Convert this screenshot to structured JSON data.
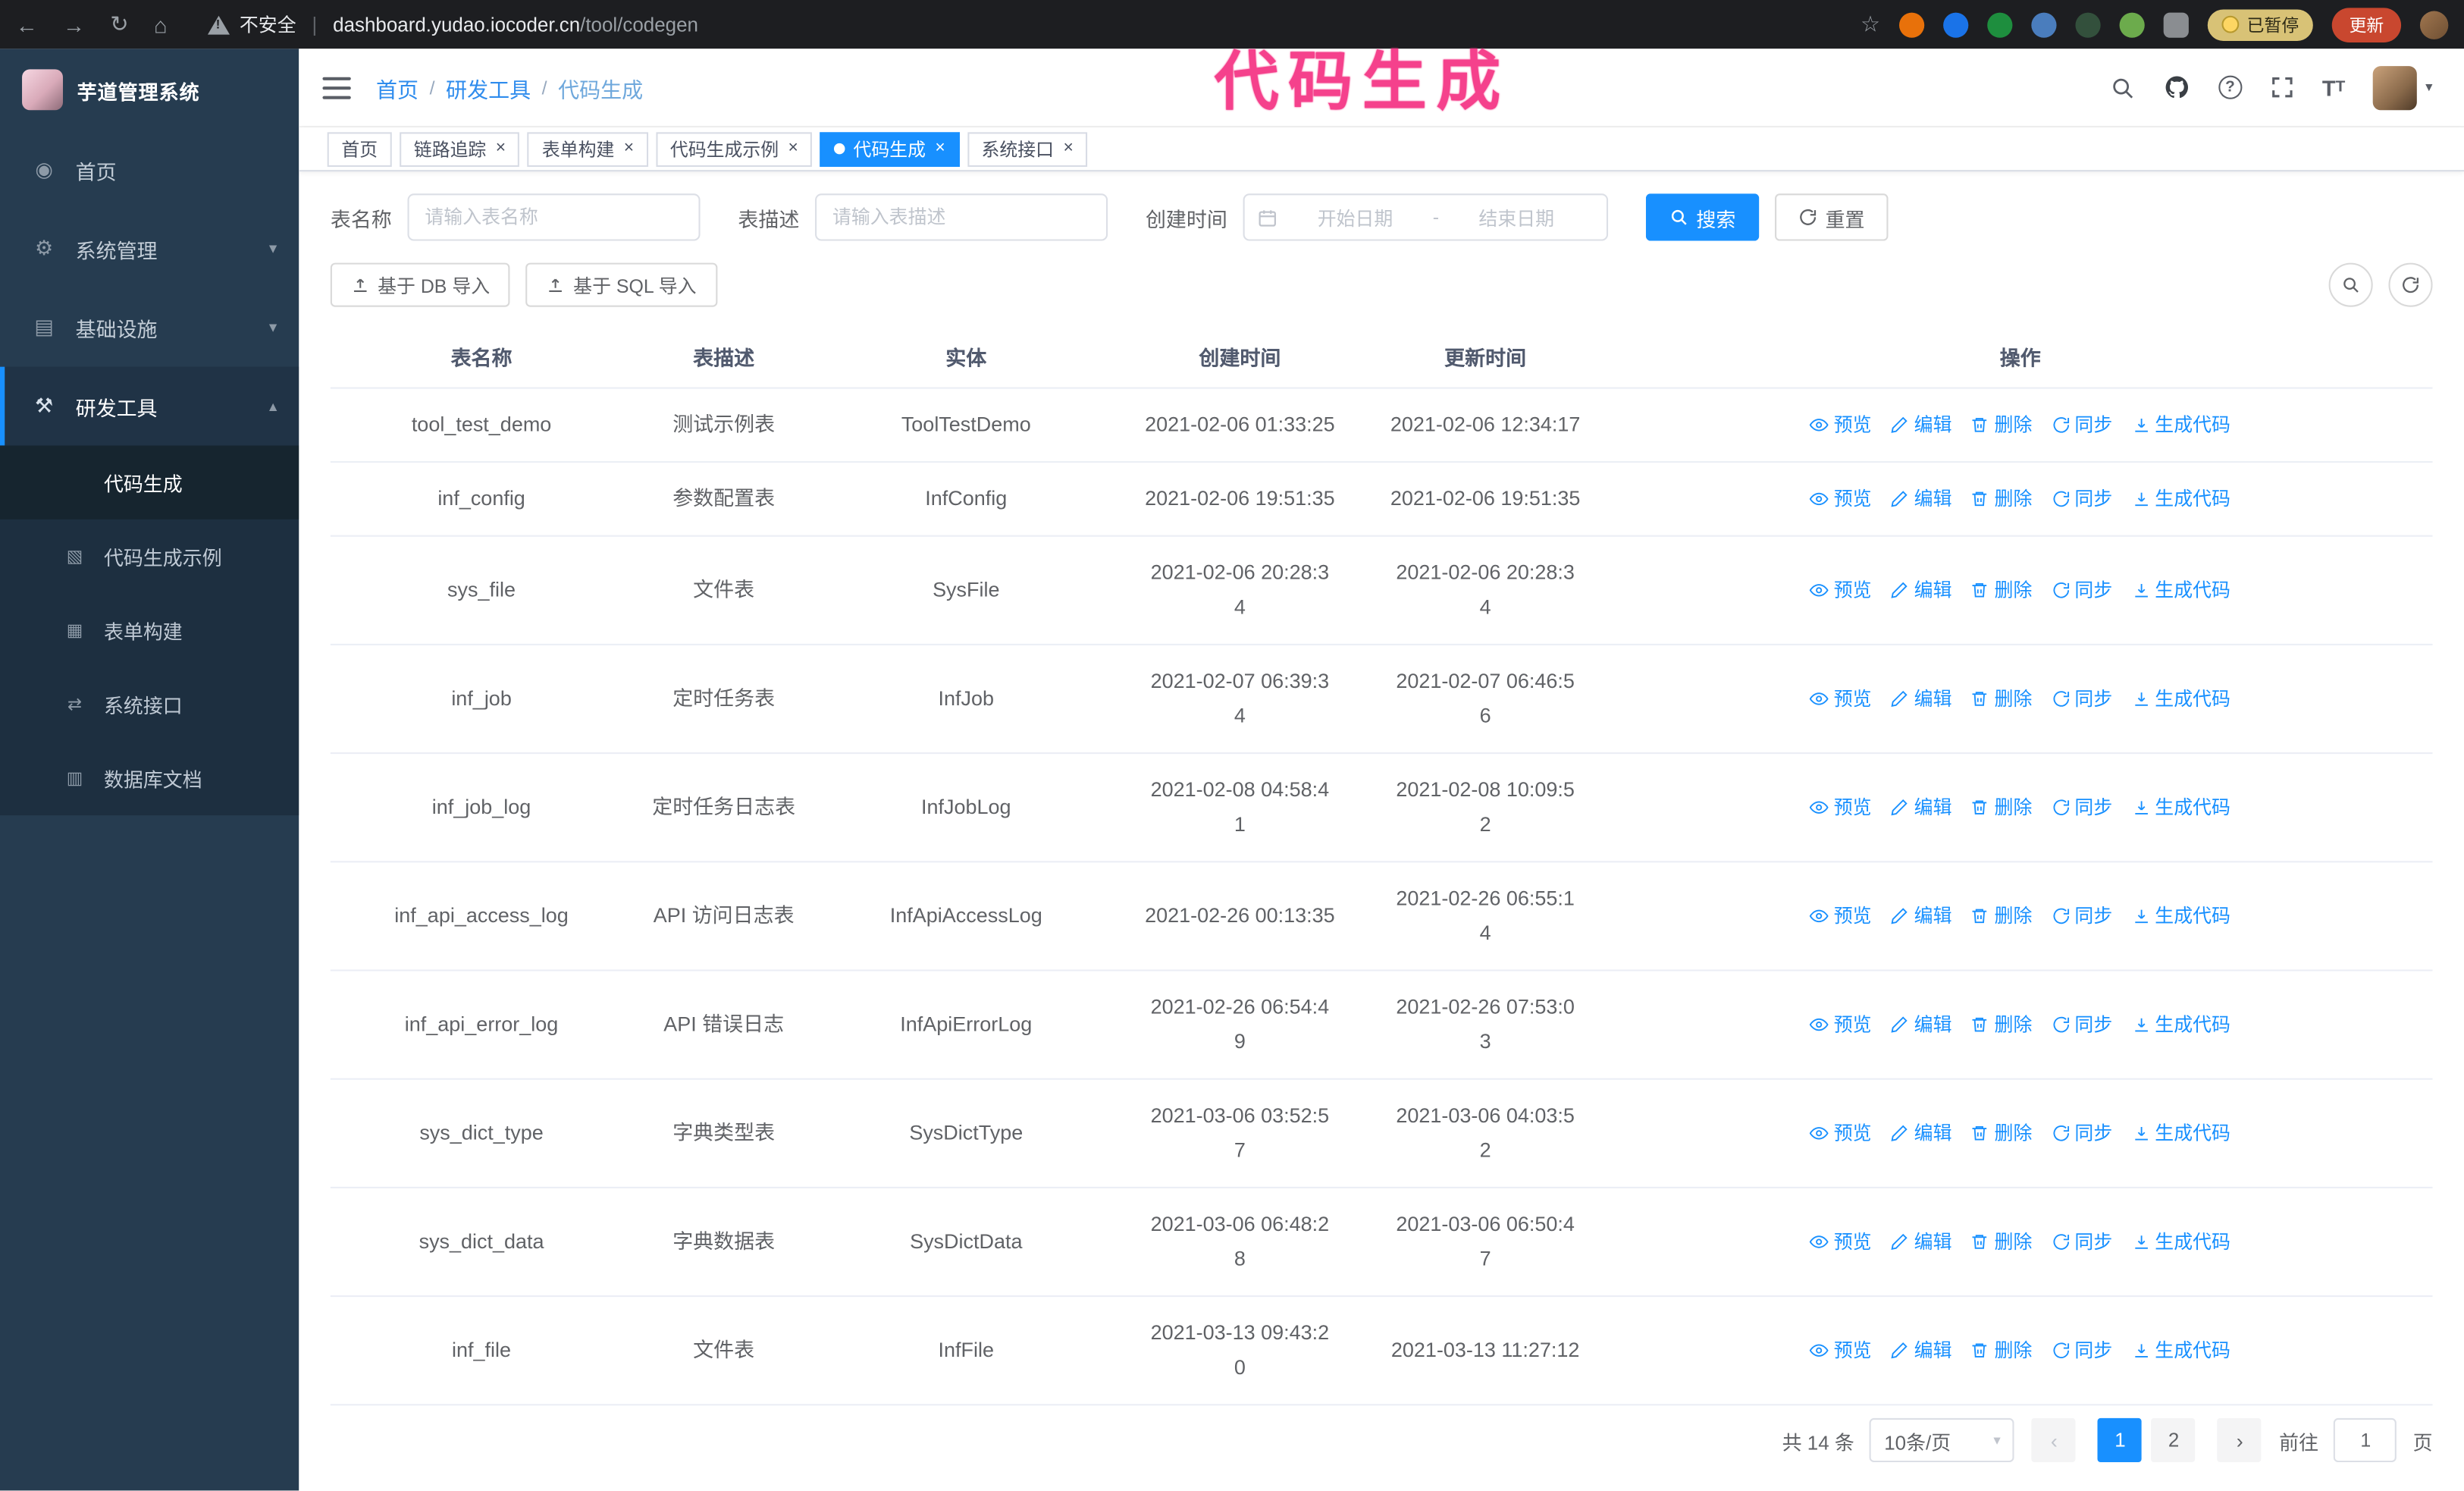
{
  "theme": {
    "primary": "#1890ff",
    "sidebar_bg": "#263c50",
    "annotation_color": "#f5418c"
  },
  "annotation": {
    "text": "代码生成"
  },
  "browser": {
    "security_label": "不安全",
    "url_host": "dashboard.yudao.iocoder.cn",
    "url_path": "/tool/codegen",
    "paused_badge": "已暂停",
    "update_button": "更新"
  },
  "sidebar": {
    "logo_text": "芋道管理系统",
    "menu": [
      {
        "id": "home",
        "label": "首页",
        "icon": "home-icon",
        "expandable": false,
        "expanded": false,
        "active": false
      },
      {
        "id": "system",
        "label": "系统管理",
        "icon": "gear-icon",
        "expandable": true,
        "expanded": false,
        "active": false
      },
      {
        "id": "infrastructure",
        "label": "基础设施",
        "icon": "infrastructure-icon",
        "expandable": true,
        "expanded": false,
        "active": false
      },
      {
        "id": "dev-tools",
        "label": "研发工具",
        "icon": "dev-tools-icon",
        "expandable": true,
        "expanded": true,
        "active": true
      }
    ],
    "submenu": [
      {
        "id": "codegen",
        "label": "代码生成",
        "icon": "code-icon",
        "active": true
      },
      {
        "id": "codegen-example",
        "label": "代码生成示例",
        "icon": "example-icon",
        "active": false
      },
      {
        "id": "form-builder",
        "label": "表单构建",
        "icon": "form-icon",
        "active": false
      },
      {
        "id": "system-api",
        "label": "系统接口",
        "icon": "api-icon",
        "active": false
      },
      {
        "id": "db-doc",
        "label": "数据库文档",
        "icon": "database-icon",
        "active": false
      }
    ]
  },
  "navbar": {
    "breadcrumb": [
      "首页",
      "研发工具",
      "代码生成"
    ]
  },
  "tabs": [
    {
      "id": "home",
      "label": "首页",
      "closable": false,
      "active": false
    },
    {
      "id": "tracer",
      "label": "链路追踪",
      "closable": true,
      "active": false
    },
    {
      "id": "form-builder",
      "label": "表单构建",
      "closable": true,
      "active": false
    },
    {
      "id": "codegen-example",
      "label": "代码生成示例",
      "closable": true,
      "active": false
    },
    {
      "id": "codegen",
      "label": "代码生成",
      "closable": true,
      "active": true
    },
    {
      "id": "system-api",
      "label": "系统接口",
      "closable": true,
      "active": false
    }
  ],
  "filters": {
    "table_name_label": "表名称",
    "table_name_placeholder": "请输入表名称",
    "table_desc_label": "表描述",
    "table_desc_placeholder": "请输入表描述",
    "create_time_label": "创建时间",
    "date_start_placeholder": "开始日期",
    "date_separator": "-",
    "date_end_placeholder": "结束日期",
    "search_button": "搜索",
    "reset_button": "重置"
  },
  "toolbar": {
    "import_db_button": "基于 DB 导入",
    "import_sql_button": "基于 SQL 导入"
  },
  "table": {
    "columns": [
      "表名称",
      "表描述",
      "实体",
      "创建时间",
      "更新时间",
      "操作"
    ],
    "row_actions": [
      "预览",
      "编辑",
      "删除",
      "同步",
      "生成代码"
    ],
    "rows": [
      {
        "name": "tool_test_demo",
        "desc": "测试示例表",
        "entity": "ToolTestDemo",
        "created": "2021-02-06 01:33:25",
        "updated": "2021-02-06 12:34:17"
      },
      {
        "name": "inf_config",
        "desc": "参数配置表",
        "entity": "InfConfig",
        "created": "2021-02-06 19:51:35",
        "updated": "2021-02-06 19:51:35"
      },
      {
        "name": "sys_file",
        "desc": "文件表",
        "entity": "SysFile",
        "created": "2021-02-06 20:28:3\n4",
        "updated": "2021-02-06 20:28:3\n4"
      },
      {
        "name": "inf_job",
        "desc": "定时任务表",
        "entity": "InfJob",
        "created": "2021-02-07 06:39:3\n4",
        "updated": "2021-02-07 06:46:5\n6"
      },
      {
        "name": "inf_job_log",
        "desc": "定时任务日志表",
        "entity": "InfJobLog",
        "created": "2021-02-08 04:58:4\n1",
        "updated": "2021-02-08 10:09:5\n2"
      },
      {
        "name": "inf_api_access_log",
        "desc": "API 访问日志表",
        "entity": "InfApiAccessLog",
        "created": "2021-02-26 00:13:35",
        "updated": "2021-02-26 06:55:1\n4"
      },
      {
        "name": "inf_api_error_log",
        "desc": "API 错误日志",
        "entity": "InfApiErrorLog",
        "created": "2021-02-26 06:54:4\n9",
        "updated": "2021-02-26 07:53:0\n3"
      },
      {
        "name": "sys_dict_type",
        "desc": "字典类型表",
        "entity": "SysDictType",
        "created": "2021-03-06 03:52:5\n7",
        "updated": "2021-03-06 04:03:5\n2"
      },
      {
        "name": "sys_dict_data",
        "desc": "字典数据表",
        "entity": "SysDictData",
        "created": "2021-03-06 06:48:2\n8",
        "updated": "2021-03-06 06:50:4\n7"
      },
      {
        "name": "inf_file",
        "desc": "文件表",
        "entity": "InfFile",
        "created": "2021-03-13 09:43:2\n0",
        "updated": "2021-03-13 11:27:12"
      }
    ]
  },
  "pagination": {
    "total_text": "共 14 条",
    "page_size": "10条/页",
    "pages": [
      "1",
      "2"
    ],
    "active_page": "1",
    "goto_label": "前往",
    "goto_value": "1",
    "goto_unit": "页"
  }
}
